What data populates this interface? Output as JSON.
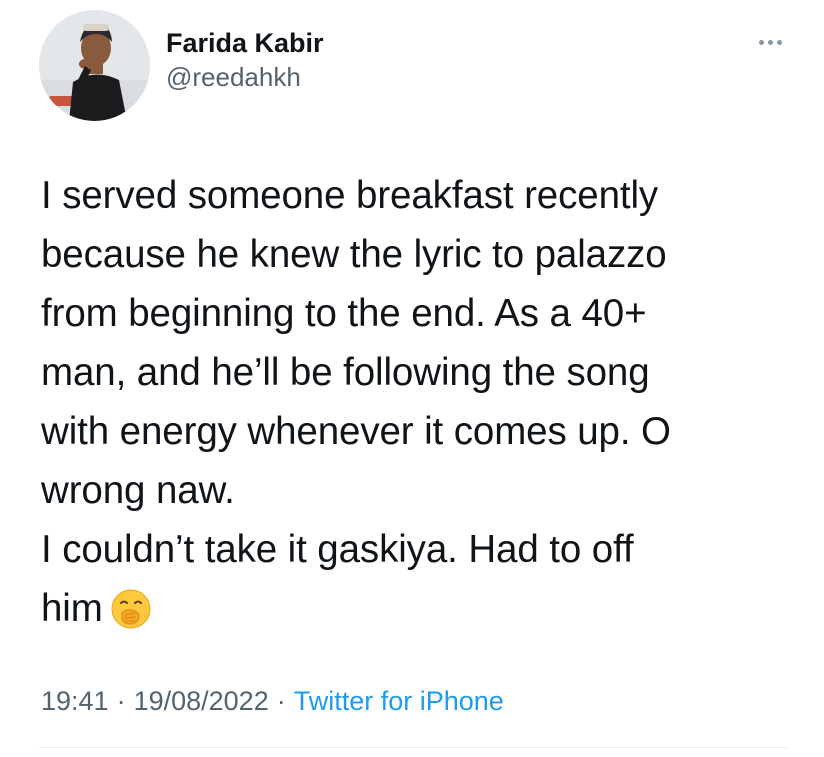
{
  "author": {
    "display_name": "Farida Kabir",
    "handle": "@reedahkh"
  },
  "icons": {
    "avatar": "profile-photo",
    "more": "more-options-icon",
    "emoji": "face-with-hand-over-mouth-emoji"
  },
  "tweet": {
    "lines": [
      "I served someone breakfast recently",
      "because he knew the lyric to palazzo",
      "from beginning to the end. As a 40+",
      "man, and he’ll be following the song",
      "with energy whenever it comes up. O",
      "wrong naw.",
      "I couldn’t take it gaskiya. Had to off",
      "him"
    ]
  },
  "meta": {
    "time": "19:41",
    "separator": "·",
    "date": "19/08/2022",
    "source": "Twitter for iPhone"
  },
  "colors": {
    "text": "#0f1419",
    "secondary": "#536471",
    "link": "#1d9bf0",
    "divider": "#eff3f4"
  }
}
